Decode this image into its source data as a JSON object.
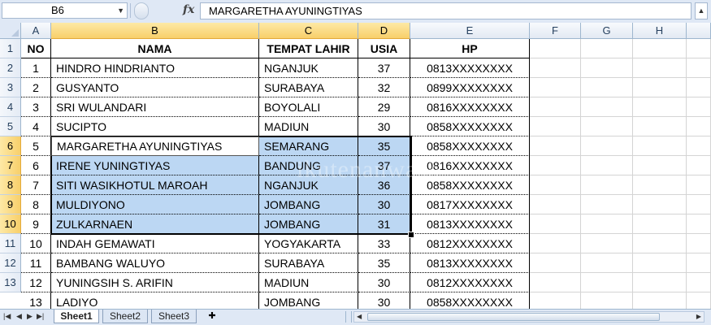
{
  "formula_bar": {
    "name_box": "B6",
    "fx_label": "fx",
    "formula": "MARGARETHA  AYUNINGTIYAS"
  },
  "columns": [
    "A",
    "B",
    "C",
    "D",
    "E",
    "F",
    "G",
    "H"
  ],
  "selected_columns": [
    "B",
    "C",
    "D"
  ],
  "row_numbers": [
    "1",
    "2",
    "3",
    "4",
    "5",
    "6",
    "7",
    "8",
    "9",
    "10",
    "11",
    "12",
    "13"
  ],
  "selected_rows": [
    "6",
    "7",
    "8",
    "9",
    "10"
  ],
  "table": {
    "headers": [
      "NO",
      "NAMA",
      "TEMPAT LAHIR",
      "USIA",
      "HP"
    ],
    "rows": [
      [
        "1",
        "HINDRO HINDRIANTO",
        "NGANJUK",
        "37",
        "0813XXXXXXXX"
      ],
      [
        "2",
        "GUSYANTO",
        "SURABAYA",
        "32",
        "0899XXXXXXXX"
      ],
      [
        "3",
        "SRI WULANDARI",
        "BOYOLALI",
        "29",
        "0816XXXXXXXX"
      ],
      [
        "4",
        "SUCIPTO",
        "MADIUN",
        "30",
        "0858XXXXXXXX"
      ],
      [
        "5",
        "MARGARETHA  AYUNINGTIYAS",
        "SEMARANG",
        "35",
        "0858XXXXXXXX"
      ],
      [
        "6",
        "IRENE YUNINGTIYAS",
        "BANDUNG",
        "37",
        "0816XXXXXXXX"
      ],
      [
        "7",
        "SITI WASIKHOTUL MAROAH",
        "NGANJUK",
        "36",
        "0858XXXXXXXX"
      ],
      [
        "8",
        "MULDIYONO",
        "JOMBANG",
        "30",
        "0817XXXXXXXX"
      ],
      [
        "9",
        "ZULKARNAEN",
        "JOMBANG",
        "31",
        "0813XXXXXXXX"
      ],
      [
        "10",
        "INDAH GEMAWATI",
        "YOGYAKARTA",
        "33",
        "0812XXXXXXXX"
      ],
      [
        "11",
        "BAMBANG WALUYO",
        "SURABAYA",
        "35",
        "0813XXXXXXXX"
      ],
      [
        "12",
        "YUNINGSIH S. ARIFIN",
        "MADIUN",
        "30",
        "0812XXXXXXXX"
      ],
      [
        "13",
        "LADIYO",
        "JOMBANG",
        "30",
        "0858XXXXXXXX"
      ]
    ]
  },
  "sheet_tabs": [
    "Sheet1",
    "Sheet2",
    "Sheet3"
  ],
  "active_sheet": "Sheet1",
  "colors": {
    "selection_fill": "#bcd7f3",
    "header_highlight": "#f8cf6a",
    "ribbon_blue": "#dfe8f5"
  }
}
